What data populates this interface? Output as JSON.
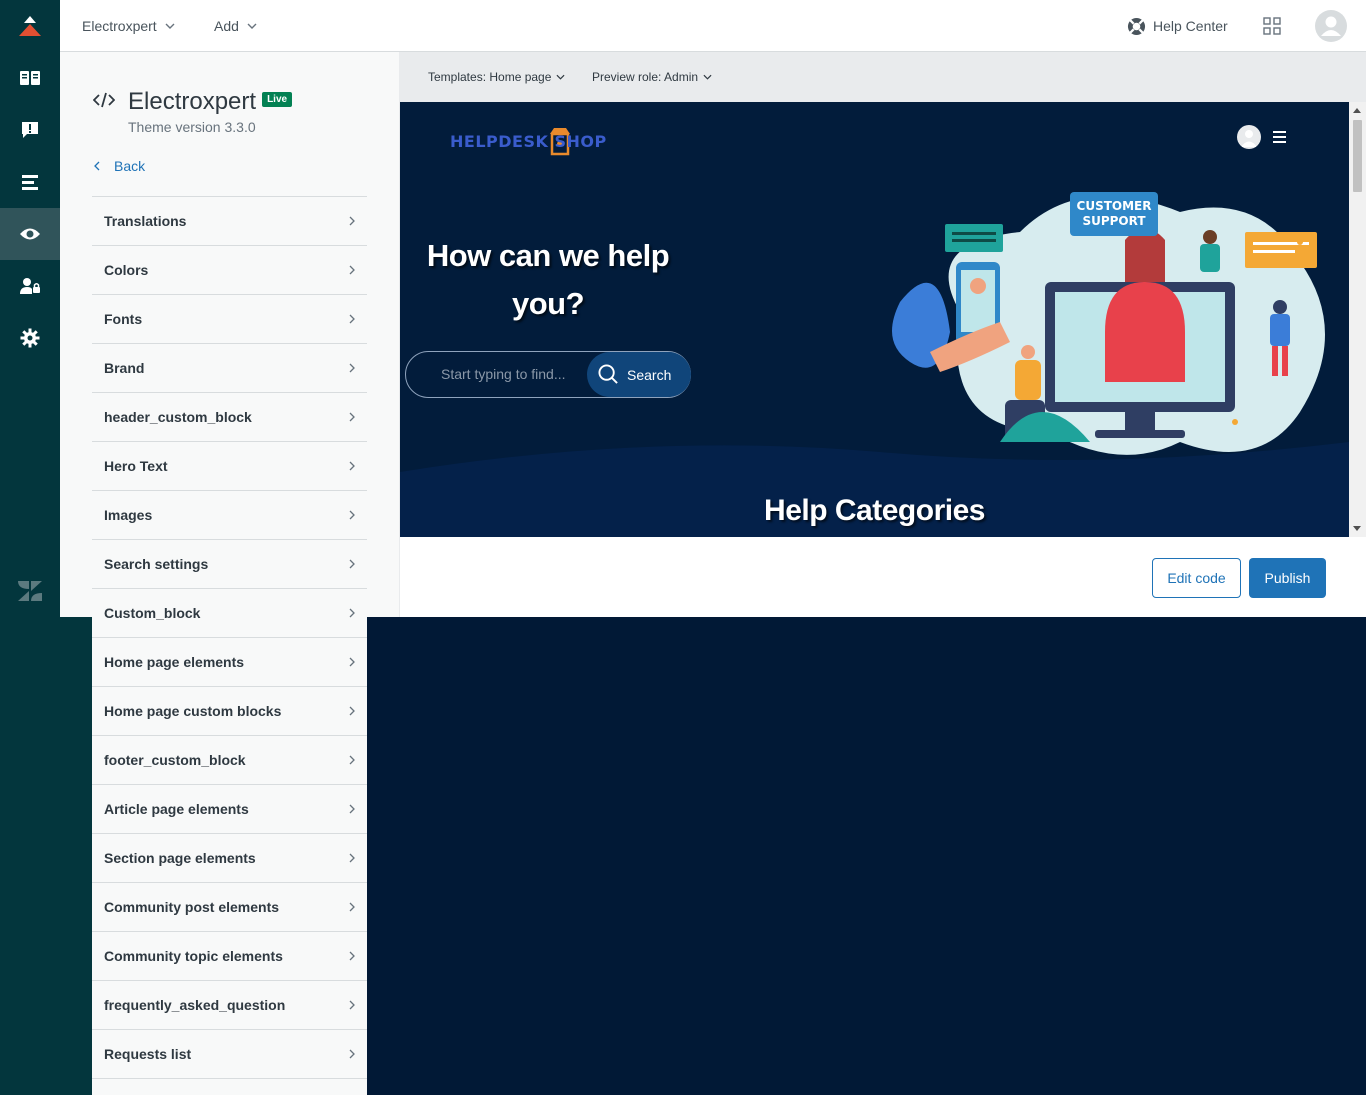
{
  "nav": {
    "items": [
      {
        "icon": "zendesk-guide-logo-icon"
      },
      {
        "icon": "book-icon"
      },
      {
        "icon": "alert-comment-icon"
      },
      {
        "icon": "list-icon"
      },
      {
        "icon": "eye-icon",
        "active": true
      },
      {
        "icon": "user-lock-icon"
      },
      {
        "icon": "gear-icon"
      },
      {
        "icon": "zendesk-icon"
      }
    ]
  },
  "topbar": {
    "brand_menu": "Electroxpert",
    "add_menu": "Add",
    "help_center": "Help Center"
  },
  "theme": {
    "name": "Electroxpert",
    "badge": "Live",
    "version": "Theme version 3.3.0",
    "back": "Back"
  },
  "settings": [
    "Translations",
    "Colors",
    "Fonts",
    "Brand",
    "header_custom_block",
    "Hero Text",
    "Images",
    "Search settings",
    "Custom_block",
    "Home page elements",
    "Home page custom blocks",
    "footer_custom_block",
    "Article page elements",
    "Section page elements",
    "Community post elements",
    "Community topic elements",
    "frequently_asked_question",
    "Requests list"
  ],
  "preview_bar": {
    "template": "Templates: Home page",
    "role": "Preview role: Admin"
  },
  "preview": {
    "logo": "HELPDESK SHOP",
    "hero_line1": "How can we help",
    "hero_line2": "you?",
    "search_placeholder": "Start typing to find...",
    "search_button": "Search",
    "categories_title": "Help Categories",
    "illustration_badge_1": "CUSTOMER",
    "illustration_badge_2": "SUPPORT"
  },
  "actions": {
    "edit_code": "Edit code",
    "publish": "Publish"
  },
  "colors": {
    "rail": "#03363d",
    "accent": "#1f73b7",
    "live": "#038153",
    "preview_bg": "#021c3b"
  }
}
